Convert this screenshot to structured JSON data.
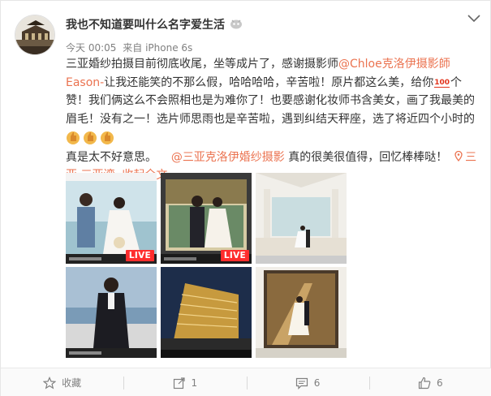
{
  "user": {
    "name": "我也不知道要叫什么名字爱生活",
    "avatar_icon": "ornate-building-avatar-icon"
  },
  "meta": {
    "time": "今天 00:05",
    "source_prefix": "来自",
    "source": "iPhone 6s"
  },
  "post": {
    "text_1": "三亚婚纱拍摄目前彻底收尾，坐等成片了，感谢摄影师",
    "mention_1": "@Chloe克洛伊摄影師Eason-",
    "text_2": "让我还能笑的不那么假，哈哈哈哈，辛苦啦！原片都这么美，给你",
    "hundred_label": "100",
    "text_3": "个赞！我们俩这么不会照相也是为难你了！也要感谢化妆师书含美女，画了我最美的眉毛！没有之一！选片师思雨也是辛苦啦，遇到纠结天秤座，选了将近四个小时的",
    "text_4": "真是太不好意思。",
    "mention_2": "@三亚克洛伊婚纱摄影",
    "text_5": "真的很美很值得，回忆棒棒哒！",
    "location_pin": "map-pin-icon",
    "location": "三亚·三亚湾",
    "collapse": "收起全文"
  },
  "photos": [
    {
      "live": "LIVE"
    },
    {
      "live": "LIVE"
    },
    {
      "live": ""
    },
    {
      "live": ""
    },
    {
      "live": ""
    },
    {
      "live": ""
    }
  ],
  "actions": {
    "favorite_label": "收藏",
    "repost_count": "1",
    "comment_count": "6",
    "like_count": "6"
  },
  "colors": {
    "link": "#eb7350",
    "live": "#ff2d2d"
  }
}
